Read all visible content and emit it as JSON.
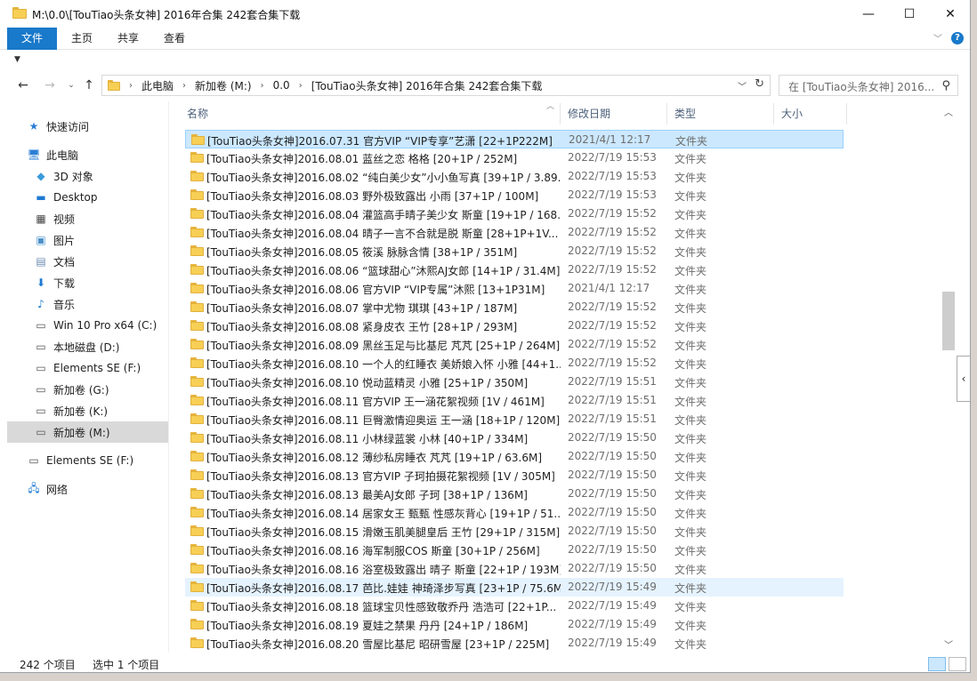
{
  "window": {
    "title": "M:\\0.0\\[TouTiao头条女神] 2016年合集 242套合集下载",
    "controls": {
      "minimize": "—",
      "maximize": "☐",
      "close": "✕"
    }
  },
  "ribbon": {
    "tabs": [
      "文件",
      "主页",
      "共享",
      "查看"
    ],
    "help": "?"
  },
  "address": {
    "crumbs": [
      "此电脑",
      "新加卷 (M:)",
      "0.0",
      "[TouTiao头条女神] 2016年合集 242套合集下载"
    ],
    "search_placeholder": "在 [TouTiao头条女神] 2016..."
  },
  "nav": {
    "items": [
      {
        "label": "快速访问",
        "icon": "star-icon"
      },
      {
        "label": "此电脑",
        "icon": "pc-icon"
      },
      {
        "label": "3D 对象",
        "icon": "cube-icon"
      },
      {
        "label": "Desktop",
        "icon": "desktop-icon"
      },
      {
        "label": "视频",
        "icon": "video-icon"
      },
      {
        "label": "图片",
        "icon": "picture-icon"
      },
      {
        "label": "文档",
        "icon": "document-icon"
      },
      {
        "label": "下载",
        "icon": "download-icon"
      },
      {
        "label": "音乐",
        "icon": "music-icon"
      },
      {
        "label": "Win 10 Pro x64 (C:)",
        "icon": "drive-icon"
      },
      {
        "label": "本地磁盘 (D:)",
        "icon": "drive-icon"
      },
      {
        "label": "Elements SE (F:)",
        "icon": "drive-icon"
      },
      {
        "label": "新加卷 (G:)",
        "icon": "drive-icon"
      },
      {
        "label": "新加卷 (K:)",
        "icon": "drive-icon"
      },
      {
        "label": "新加卷 (M:)",
        "icon": "drive-icon"
      },
      {
        "label": "Elements SE (F:)",
        "icon": "drive-icon"
      },
      {
        "label": "网络",
        "icon": "network-icon"
      }
    ]
  },
  "columns": {
    "name": "名称",
    "date": "修改日期",
    "type": "类型",
    "size": "大小"
  },
  "files": [
    {
      "name": "[TouTiao头条女神]2016.07.31 官方VIP “VIP专享”艺潇 [22+1P222M]",
      "date": "2021/4/1 12:17",
      "type": "文件夹"
    },
    {
      "name": "[TouTiao头条女神]2016.08.01 蓝丝之恋 格格 [20+1P / 252M]",
      "date": "2022/7/19 15:53",
      "type": "文件夹"
    },
    {
      "name": "[TouTiao头条女神]2016.08.02 “纯白美少女”小小鱼写真 [39+1P / 3.89...",
      "date": "2022/7/19 15:53",
      "type": "文件夹"
    },
    {
      "name": "[TouTiao头条女神]2016.08.03 野外极致露出 小雨 [37+1P / 100M]",
      "date": "2022/7/19 15:53",
      "type": "文件夹"
    },
    {
      "name": "[TouTiao头条女神]2016.08.04 灌篮高手晴子美少女 斯童 [19+1P / 168...",
      "date": "2022/7/19 15:52",
      "type": "文件夹"
    },
    {
      "name": "[TouTiao头条女神]2016.08.04 晴子一言不合就是脱 斯童 [28+1P+1V...",
      "date": "2022/7/19 15:52",
      "type": "文件夹"
    },
    {
      "name": "[TouTiao头条女神]2016.08.05 筱溪 脉脉含情 [38+1P / 351M]",
      "date": "2022/7/19 15:52",
      "type": "文件夹"
    },
    {
      "name": "[TouTiao头条女神]2016.08.06 “篮球甜心”沐熙AJ女郎 [14+1P / 31.4M]",
      "date": "2022/7/19 15:52",
      "type": "文件夹"
    },
    {
      "name": "[TouTiao头条女神]2016.08.06 官方VIP “VIP专属”沐熙 [13+1P31M]",
      "date": "2021/4/1 12:17",
      "type": "文件夹"
    },
    {
      "name": "[TouTiao头条女神]2016.08.07 掌中尤物 琪琪 [43+1P / 187M]",
      "date": "2022/7/19 15:52",
      "type": "文件夹"
    },
    {
      "name": "[TouTiao头条女神]2016.08.08 紧身皮衣 王竹 [28+1P / 293M]",
      "date": "2022/7/19 15:52",
      "type": "文件夹"
    },
    {
      "name": "[TouTiao头条女神]2016.08.09 黑丝玉足与比基尼 芃芃 [25+1P / 264M]",
      "date": "2022/7/19 15:52",
      "type": "文件夹"
    },
    {
      "name": "[TouTiao头条女神]2016.08.10 一个人的红睡衣 美娇娘入怀 小雅 [44+1...",
      "date": "2022/7/19 15:52",
      "type": "文件夹"
    },
    {
      "name": "[TouTiao头条女神]2016.08.10 悦动蓝精灵 小雅 [25+1P / 350M]",
      "date": "2022/7/19 15:51",
      "type": "文件夹"
    },
    {
      "name": "[TouTiao头条女神]2016.08.11 官方VIP 王一涵花絮视频 [1V / 461M]",
      "date": "2022/7/19 15:51",
      "type": "文件夹"
    },
    {
      "name": "[TouTiao头条女神]2016.08.11 巨臀激情迎奥运 王一涵 [18+1P / 120M]",
      "date": "2022/7/19 15:51",
      "type": "文件夹"
    },
    {
      "name": "[TouTiao头条女神]2016.08.11 小林绿蓝裳 小林 [40+1P / 334M]",
      "date": "2022/7/19 15:50",
      "type": "文件夹"
    },
    {
      "name": "[TouTiao头条女神]2016.08.12 薄纱私房睡衣 芃芃 [19+1P / 63.6M]",
      "date": "2022/7/19 15:50",
      "type": "文件夹"
    },
    {
      "name": "[TouTiao头条女神]2016.08.13 官方VIP 子珂拍摄花絮视频 [1V / 305M]",
      "date": "2022/7/19 15:50",
      "type": "文件夹"
    },
    {
      "name": "[TouTiao头条女神]2016.08.13 最美AJ女郎 子珂 [38+1P / 136M]",
      "date": "2022/7/19 15:50",
      "type": "文件夹"
    },
    {
      "name": "[TouTiao头条女神]2016.08.14 居家女王 甄甄 性感灰背心 [19+1P / 51....",
      "date": "2022/7/19 15:50",
      "type": "文件夹"
    },
    {
      "name": "[TouTiao头条女神]2016.08.15 滑嫩玉肌美腿皇后 王竹 [29+1P / 315M]",
      "date": "2022/7/19 15:50",
      "type": "文件夹"
    },
    {
      "name": "[TouTiao头条女神]2016.08.16 海军制服COS 斯童 [30+1P / 256M]",
      "date": "2022/7/19 15:50",
      "type": "文件夹"
    },
    {
      "name": "[TouTiao头条女神]2016.08.16 浴室极致露出 晴子 斯童 [22+1P / 193M]",
      "date": "2022/7/19 15:50",
      "type": "文件夹"
    },
    {
      "name": "[TouTiao头条女神]2016.08.17 芭比.娃娃 神琦泽步写真 [23+1P / 75.6M]",
      "date": "2022/7/19 15:49",
      "type": "文件夹"
    },
    {
      "name": "[TouTiao头条女神]2016.08.18 篮球宝贝性感致敬乔丹 浩浩可 [22+1P...",
      "date": "2022/7/19 15:49",
      "type": "文件夹"
    },
    {
      "name": "[TouTiao头条女神]2016.08.19 夏娃之禁果 丹丹 [24+1P / 186M]",
      "date": "2022/7/19 15:49",
      "type": "文件夹"
    },
    {
      "name": "[TouTiao头条女神]2016.08.20 雪屋比基尼 昭研雪屋 [23+1P / 225M]",
      "date": "2022/7/19 15:49",
      "type": "文件夹"
    }
  ],
  "status": {
    "count": "242 个项目",
    "selected": "选中 1 个项目"
  }
}
